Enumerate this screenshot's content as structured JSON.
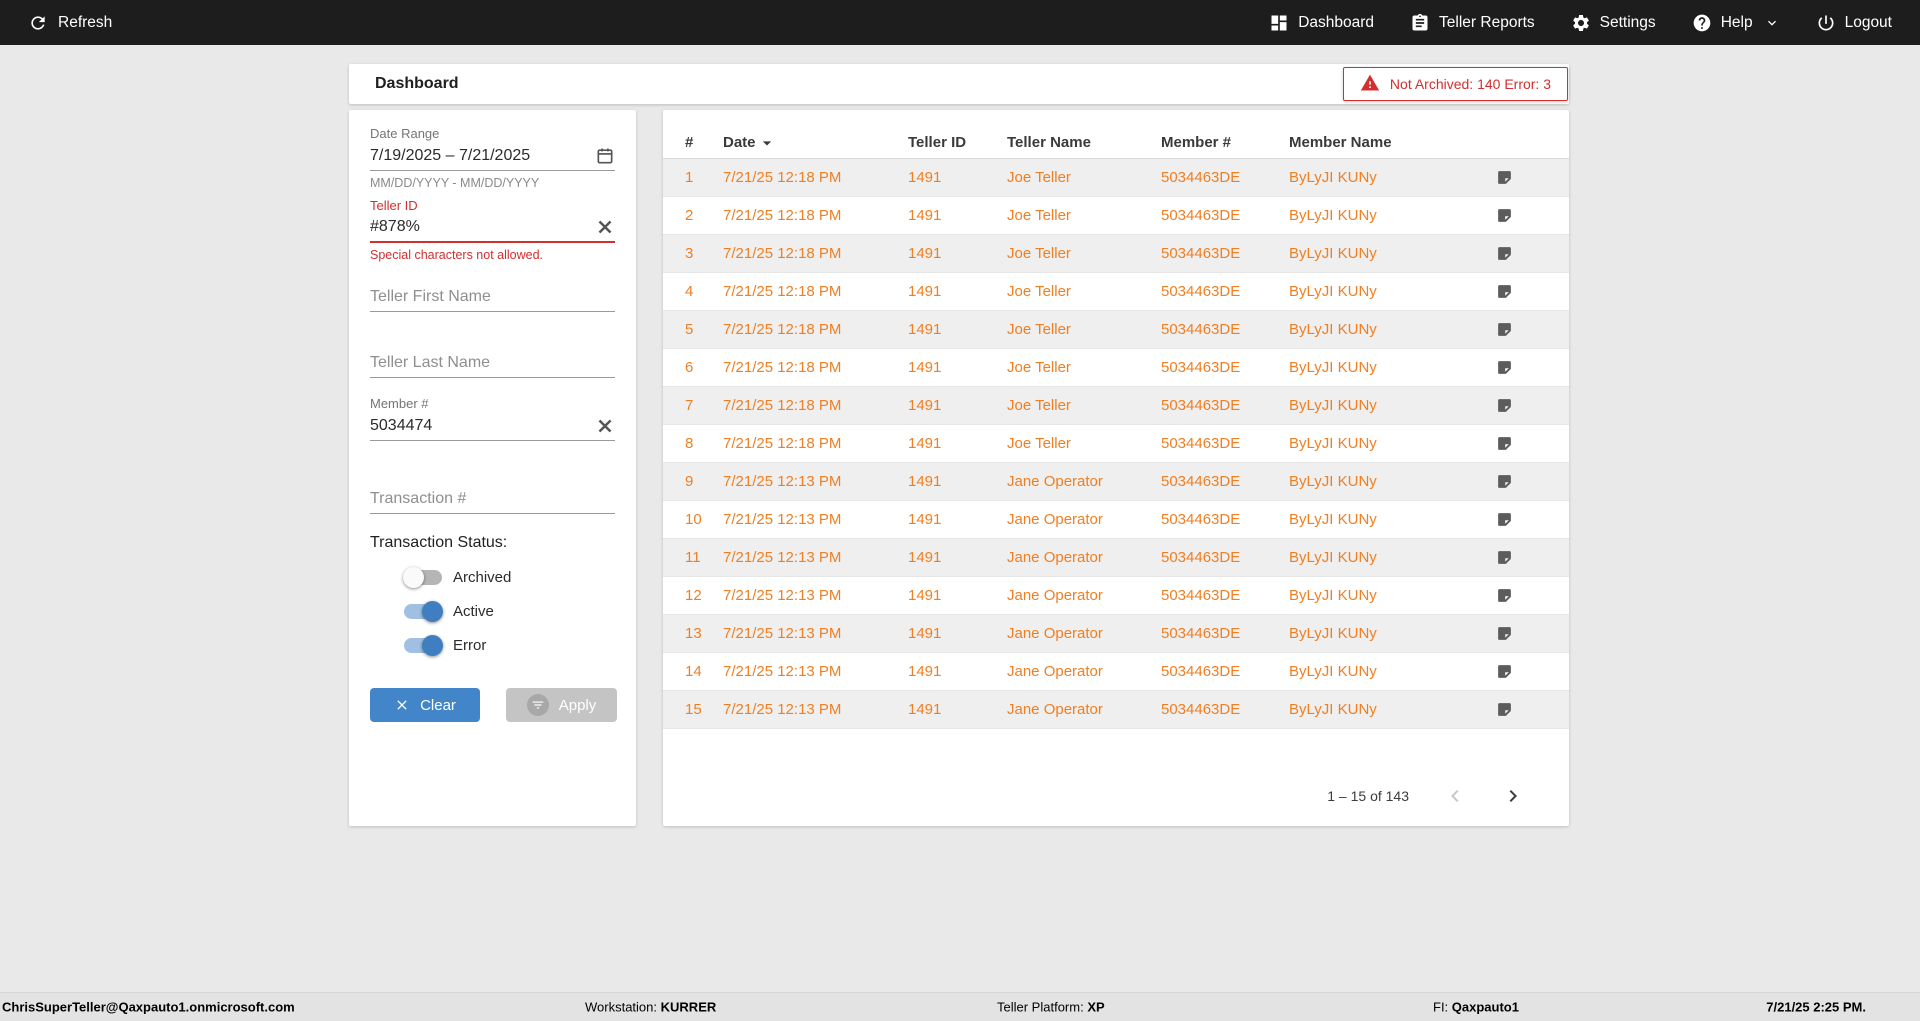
{
  "topbar": {
    "refresh_label": "Refresh",
    "nav": [
      {
        "label": "Dashboard",
        "icon": "dashboard-icon"
      },
      {
        "label": "Teller Reports",
        "icon": "reports-icon"
      },
      {
        "label": "Settings",
        "icon": "settings-icon"
      },
      {
        "label": "Help",
        "icon": "help-icon"
      },
      {
        "label": "Logout",
        "icon": "power-icon"
      }
    ]
  },
  "header": {
    "title": "Dashboard",
    "alert_text": "Not Archived: 140  Error: 3"
  },
  "filters": {
    "date_range": {
      "label": "Date Range",
      "value": "7/19/2025 – 7/21/2025",
      "helper": "MM/DD/YYYY - MM/DD/YYYY"
    },
    "teller_id": {
      "label": "Teller ID",
      "value": "#878%",
      "error": "Special characters not allowed."
    },
    "teller_first_name": {
      "placeholder": "Teller First Name"
    },
    "teller_last_name": {
      "placeholder": "Teller Last Name"
    },
    "member_number": {
      "label": "Member #",
      "value": "5034474"
    },
    "transaction_number": {
      "placeholder": "Transaction #"
    },
    "status": {
      "label": "Transaction Status:",
      "toggles": [
        {
          "label": "Archived",
          "on": false
        },
        {
          "label": "Active",
          "on": true
        },
        {
          "label": "Error",
          "on": true
        }
      ]
    },
    "clear_label": "Clear",
    "apply_label": "Apply"
  },
  "table": {
    "columns": [
      "#",
      "Date",
      "Teller ID",
      "Teller Name",
      "Member #",
      "Member Name"
    ],
    "sort_column": "Date",
    "row_icon": "note-icon",
    "rows": [
      {
        "num": "1",
        "date": "7/21/25 12:18 PM",
        "teller_id": "1491",
        "teller_name": "Joe Teller",
        "member_num": "5034463DE",
        "member_name": "ByLyJI KUNy"
      },
      {
        "num": "2",
        "date": "7/21/25 12:18 PM",
        "teller_id": "1491",
        "teller_name": "Joe Teller",
        "member_num": "5034463DE",
        "member_name": "ByLyJI KUNy"
      },
      {
        "num": "3",
        "date": "7/21/25 12:18 PM",
        "teller_id": "1491",
        "teller_name": "Joe Teller",
        "member_num": "5034463DE",
        "member_name": "ByLyJI KUNy"
      },
      {
        "num": "4",
        "date": "7/21/25 12:18 PM",
        "teller_id": "1491",
        "teller_name": "Joe Teller",
        "member_num": "5034463DE",
        "member_name": "ByLyJI KUNy"
      },
      {
        "num": "5",
        "date": "7/21/25 12:18 PM",
        "teller_id": "1491",
        "teller_name": "Joe Teller",
        "member_num": "5034463DE",
        "member_name": "ByLyJI KUNy"
      },
      {
        "num": "6",
        "date": "7/21/25 12:18 PM",
        "teller_id": "1491",
        "teller_name": "Joe Teller",
        "member_num": "5034463DE",
        "member_name": "ByLyJI KUNy"
      },
      {
        "num": "7",
        "date": "7/21/25 12:18 PM",
        "teller_id": "1491",
        "teller_name": "Joe Teller",
        "member_num": "5034463DE",
        "member_name": "ByLyJI KUNy"
      },
      {
        "num": "8",
        "date": "7/21/25 12:18 PM",
        "teller_id": "1491",
        "teller_name": "Joe Teller",
        "member_num": "5034463DE",
        "member_name": "ByLyJI KUNy"
      },
      {
        "num": "9",
        "date": "7/21/25 12:13 PM",
        "teller_id": "1491",
        "teller_name": "Jane Operator",
        "member_num": "5034463DE",
        "member_name": "ByLyJI KUNy"
      },
      {
        "num": "10",
        "date": "7/21/25 12:13 PM",
        "teller_id": "1491",
        "teller_name": "Jane Operator",
        "member_num": "5034463DE",
        "member_name": "ByLyJI KUNy"
      },
      {
        "num": "11",
        "date": "7/21/25 12:13 PM",
        "teller_id": "1491",
        "teller_name": "Jane Operator",
        "member_num": "5034463DE",
        "member_name": "ByLyJI KUNy"
      },
      {
        "num": "12",
        "date": "7/21/25 12:13 PM",
        "teller_id": "1491",
        "teller_name": "Jane Operator",
        "member_num": "5034463DE",
        "member_name": "ByLyJI KUNy"
      },
      {
        "num": "13",
        "date": "7/21/25 12:13 PM",
        "teller_id": "1491",
        "teller_name": "Jane Operator",
        "member_num": "5034463DE",
        "member_name": "ByLyJI KUNy"
      },
      {
        "num": "14",
        "date": "7/21/25 12:13 PM",
        "teller_id": "1491",
        "teller_name": "Jane Operator",
        "member_num": "5034463DE",
        "member_name": "ByLyJI KUNy"
      },
      {
        "num": "15",
        "date": "7/21/25 12:13 PM",
        "teller_id": "1491",
        "teller_name": "Jane Operator",
        "member_num": "5034463DE",
        "member_name": "ByLyJI KUNy"
      }
    ],
    "pagination": {
      "range_label": "1 – 15 of 143"
    }
  },
  "statusbar": {
    "user": "ChrisSuperTeller@Qaxpauto1.onmicrosoft.com",
    "workstation_label": "Workstation:",
    "workstation_value": "KURRER",
    "platform_label": "Teller Platform:",
    "platform_value": "XP",
    "fi_label": "FI:",
    "fi_value": "Qaxpauto1",
    "datetime": "7/21/25 2:25 PM."
  },
  "colors": {
    "accent_orange": "#ef7f22",
    "accent_blue": "#4285c8",
    "error_red": "#d32f2f",
    "topbar_bg": "#1d1d1d"
  }
}
